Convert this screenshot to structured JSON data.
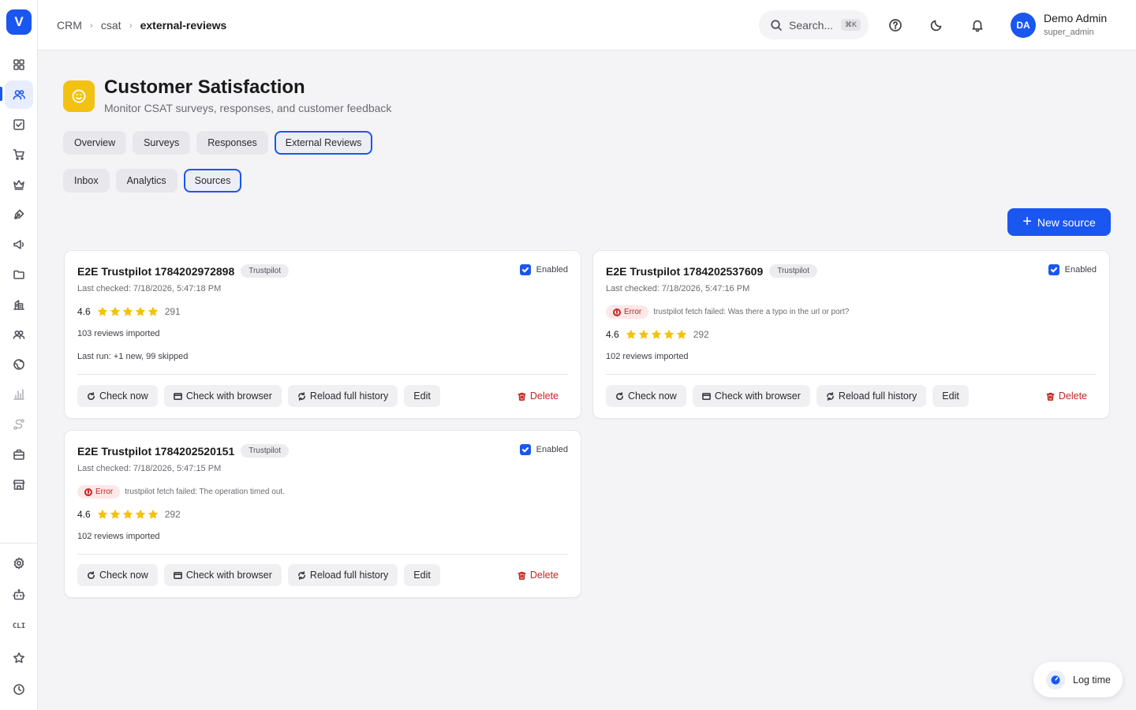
{
  "sidebar": {
    "logo_letter": "V",
    "cli_label": "CLI",
    "nav_icons": [
      "grid-icon",
      "users-icon",
      "checkbox-icon",
      "cart-icon",
      "crown-icon",
      "pen-tool-icon",
      "megaphone-icon",
      "folder-icon",
      "building-icon",
      "people-icon",
      "globe-icon",
      "bar-chart-icon",
      "route-icon",
      "briefcase-icon",
      "store-icon"
    ],
    "bottom_icons": [
      "settings-icon",
      "bot-icon",
      "cli-icon",
      "star-icon",
      "clock-icon"
    ]
  },
  "header": {
    "breadcrumb": [
      "CRM",
      "csat",
      "external-reviews"
    ],
    "search_placeholder": "Search...",
    "search_shortcut": "⌘K",
    "user_initials": "DA",
    "user_name": "Demo Admin",
    "user_role": "super_admin"
  },
  "page": {
    "title": "Customer Satisfaction",
    "subtitle": "Monitor CSAT surveys, responses, and customer feedback",
    "main_tabs": [
      "Overview",
      "Surveys",
      "Responses",
      "External Reviews"
    ],
    "main_tab_active": "External Reviews",
    "sub_tabs": [
      "Inbox",
      "Analytics",
      "Sources"
    ],
    "sub_tab_active": "Sources",
    "new_source_label": "New source"
  },
  "action_labels": {
    "check_now": "Check now",
    "check_browser": "Check with browser",
    "reload": "Reload full history",
    "edit": "Edit",
    "delete": "Delete",
    "enabled": "Enabled",
    "error": "Error"
  },
  "sources": [
    {
      "name": "E2E Trustpilot 1784202972898",
      "platform": "Trustpilot",
      "enabled": true,
      "last_checked": "Last checked: 7/18/2026, 5:47:18 PM",
      "error_message": null,
      "rating": "4.6",
      "stars": 5,
      "review_count": "291",
      "imported": "103 reviews imported",
      "last_run": "Last run: +1 new, 99 skipped"
    },
    {
      "name": "E2E Trustpilot 1784202537609",
      "platform": "Trustpilot",
      "enabled": true,
      "last_checked": "Last checked: 7/18/2026, 5:47:16 PM",
      "error_message": "trustpilot fetch failed: Was there a typo in the url or port?",
      "rating": "4.6",
      "stars": 5,
      "review_count": "292",
      "imported": "102 reviews imported",
      "last_run": null
    },
    {
      "name": "E2E Trustpilot 1784202520151",
      "platform": "Trustpilot",
      "enabled": true,
      "last_checked": "Last checked: 7/18/2026, 5:47:15 PM",
      "error_message": "trustpilot fetch failed: The operation timed out.",
      "rating": "4.6",
      "stars": 5,
      "review_count": "292",
      "imported": "102 reviews imported",
      "last_run": null
    }
  ],
  "log_time_label": "Log time",
  "colors": {
    "accent": "#1a56f0",
    "page_icon": "#f3c111",
    "star": "#f4c20d",
    "error": "#c42525",
    "error_bg": "#fde7e7"
  }
}
